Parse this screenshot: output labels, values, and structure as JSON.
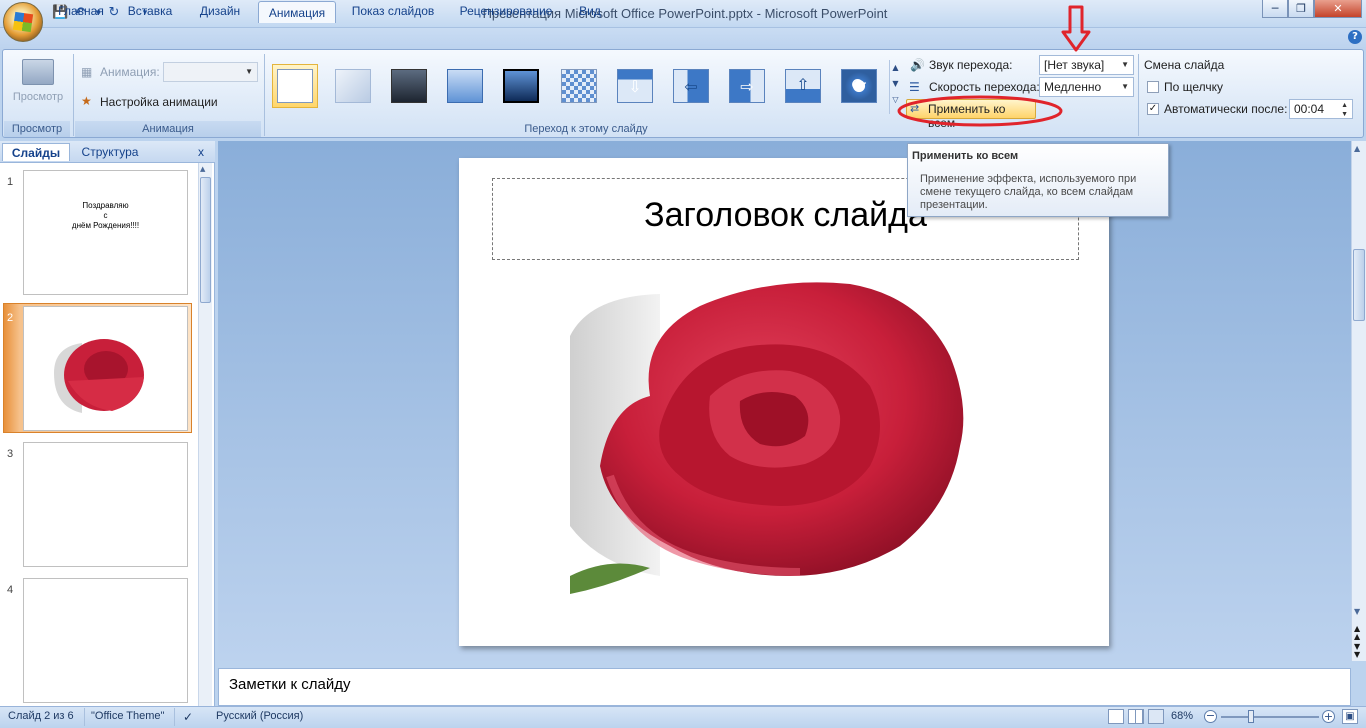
{
  "window": {
    "title": "Презентация Microsoft Office PowerPoint.pptx - Microsoft PowerPoint",
    "controls": [
      "minimize",
      "maximize",
      "close"
    ]
  },
  "quick_access": [
    "save-icon",
    "undo-icon",
    "redo-icon",
    "customize-icon"
  ],
  "ribbon_tabs": [
    {
      "label": "Главная"
    },
    {
      "label": "Вставка"
    },
    {
      "label": "Дизайн"
    },
    {
      "label": "Анимация",
      "active": true
    },
    {
      "label": "Показ слайдов"
    },
    {
      "label": "Рецензирование"
    },
    {
      "label": "Вид"
    }
  ],
  "groups": {
    "preview": {
      "button": "Просмотр",
      "label": "Просмотр"
    },
    "animation": {
      "animation_label": "Анимация:",
      "animation_value": "",
      "custom_animation": "Настройка анимации",
      "label": "Анимация"
    },
    "transition": {
      "label": "Переход к этому слайду"
    },
    "transition_options": {
      "sound_label": "Звук перехода:",
      "sound_value": "[Нет звука]",
      "speed_label": "Скорость перехода:",
      "speed_value": "Медленно",
      "apply_all": "Применить ко всем"
    },
    "advance": {
      "title": "Смена слайда",
      "on_click": "По щелчку",
      "on_click_checked": false,
      "auto_after": "Автоматически после:",
      "auto_after_checked": true,
      "time": "00:04"
    }
  },
  "panes": {
    "slides_tab": "Слайды",
    "outline_tab": "Структура",
    "close": "x"
  },
  "slides": [
    {
      "number": "1",
      "lines": [
        "Поздравляю",
        "с",
        "днём Рождения!!!!"
      ]
    },
    {
      "number": "2",
      "selected": true
    },
    {
      "number": "3"
    },
    {
      "number": "4"
    }
  ],
  "current_slide": {
    "title": "Заголовок слайда"
  },
  "notes_placeholder": "Заметки к слайду",
  "tooltip": {
    "title": "Применить ко всем",
    "body": "Применение эффекта, используемого при смене текущего слайда, ко всем слайдам презентации."
  },
  "status": {
    "slide": "Слайд 2 из 6",
    "theme": "\"Office Theme\"",
    "language": "Русский (Россия)",
    "zoom": "68%"
  },
  "colors": {
    "annotation": "#e0242b",
    "ribbon_accent": "#15428b",
    "selected_thumb": "#e8903a"
  }
}
